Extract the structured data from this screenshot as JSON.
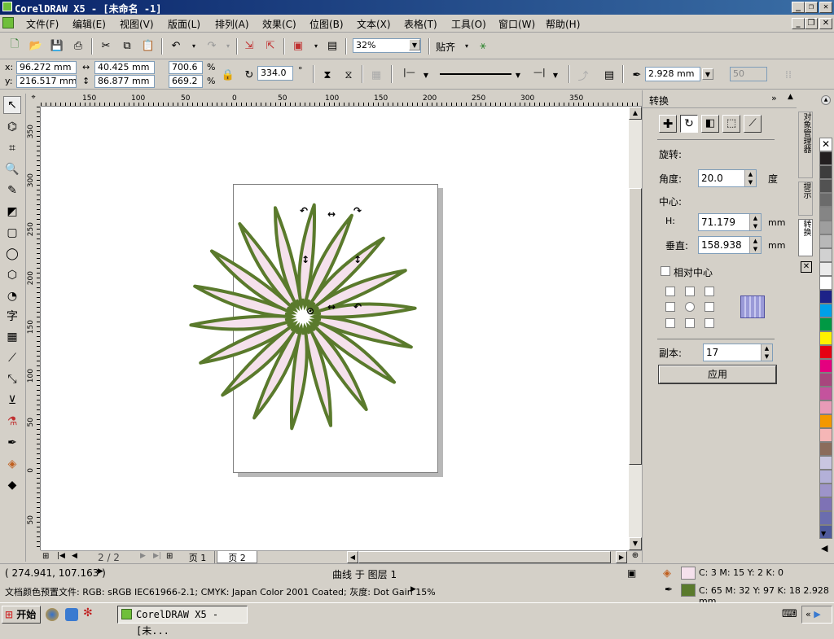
{
  "window": {
    "title": "CorelDRAW X5 - [未命名 -1]"
  },
  "menu": [
    "文件(F)",
    "编辑(E)",
    "视图(V)",
    "版面(L)",
    "排列(A)",
    "效果(C)",
    "位图(B)",
    "文本(X)",
    "表格(T)",
    "工具(O)",
    "窗口(W)",
    "帮助(H)"
  ],
  "toolbar": {
    "zoom": "32%",
    "snap_label": "贴齐"
  },
  "propbar": {
    "x_label": "x:",
    "x": "96.272 mm",
    "y_label": "y:",
    "y": "216.517 mm",
    "w": "40.425 mm",
    "h": "86.877 mm",
    "sx": "700.6",
    "sy": "669.2",
    "pct": "%",
    "rotation": "334.0",
    "deg": "°",
    "outline": "2.928 mm",
    "val50": "50"
  },
  "rulers": {
    "top": [
      "150",
      "100",
      "50",
      "0",
      "50",
      "100",
      "150",
      "200",
      "250",
      "300",
      "350"
    ],
    "left": [
      "350",
      "300",
      "250",
      "200",
      "150",
      "100",
      "50",
      "0",
      "50"
    ]
  },
  "pages": {
    "counter": "2 / 2",
    "tabs": [
      "页 1",
      "页 2"
    ],
    "active": 1
  },
  "docker": {
    "title": "转换",
    "section": "旋转:",
    "angle_label": "角度:",
    "angle": "20.0",
    "angle_unit": "度",
    "center_label": "中心:",
    "h_label": "H:",
    "h": "71.179",
    "h_unit": "mm",
    "v_label": "垂直:",
    "v": "158.938",
    "v_unit": "mm",
    "relative_center": "相对中心",
    "copies_label": "副本:",
    "copies": "17",
    "apply": "应用"
  },
  "vtabs": [
    "对象管理器",
    "提示",
    "转换"
  ],
  "palette": [
    "none",
    "#231f20",
    "#3d3d3d",
    "#525252",
    "#6b6b6b",
    "#858585",
    "#9e9e9e",
    "#b8b8b8",
    "#d1d1d1",
    "#ebebeb",
    "#ffffff",
    "#1d2288",
    "#00a0e9",
    "#009944",
    "#fff100",
    "#e60012",
    "#e4007f",
    "#a8467d",
    "#c4539d",
    "#e89bb7",
    "#f39800",
    "#f5b6b6",
    "#8b6c5c",
    "#c9c6e0",
    "#b3b0d8",
    "#9d94c9",
    "#7e72b5",
    "#6b6dae",
    "#505b9d"
  ],
  "status": {
    "coords": "( 274.941, 107.163 )",
    "object": "曲线 于 图层 1",
    "fill": "C: 3 M: 15 Y: 2 K: 0",
    "fill_color": "#f5e1ec",
    "outline_text": "C: 65 M: 32 Y: 97 K: 18  2.928 mm",
    "outline_color": "#5a7a2c",
    "profile": "文档颜色预置文件: RGB: sRGB IEC61966-2.1; CMYK: Japan Color 2001 Coated; 灰度: Dot Gain 15%"
  },
  "taskbar": {
    "start": "开始",
    "task": "CorelDRAW X5 - [未..."
  },
  "shape": {
    "petals": 18,
    "fill": "#f5e1ec",
    "stroke": "#5a7a2c"
  }
}
